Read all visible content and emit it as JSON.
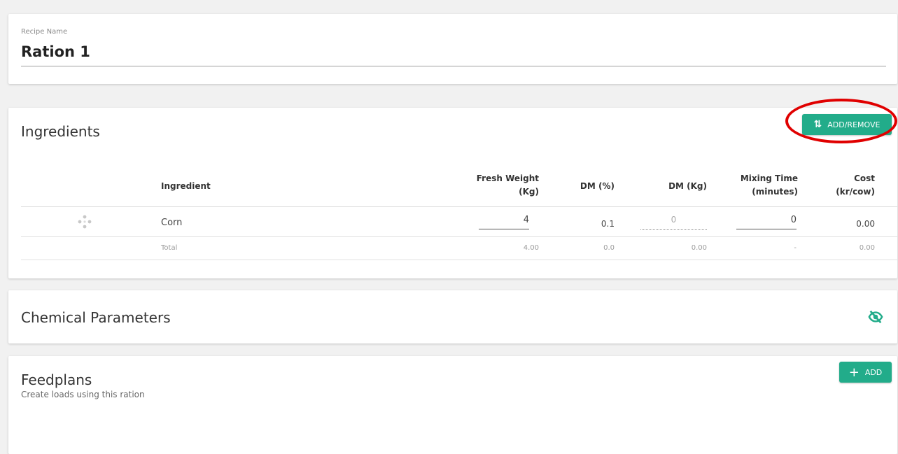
{
  "recipe": {
    "label": "Recipe Name",
    "name": "Ration 1"
  },
  "ingredients": {
    "title": "Ingredients",
    "add_remove_label": "ADD/REMOVE",
    "add_remove_icon": "swap-vertical-icon",
    "columns": {
      "ingredient": "Ingredient",
      "fresh_weight_1": "Fresh Weight",
      "fresh_weight_2": "(Kg)",
      "dm_pct": "DM (%)",
      "dm_kg": "DM (Kg)",
      "mixing_time_1": "Mixing Time",
      "mixing_time_2": "(minutes)",
      "cost_1": "Cost",
      "cost_2": "(kr/cow)"
    },
    "rows": [
      {
        "drag_icon": "drag-move-icon",
        "name": "Corn",
        "fresh_weight": "4",
        "dm_pct": "0.1",
        "dm_kg": "0",
        "mixing_time": "0",
        "cost": "0.00"
      }
    ],
    "total": {
      "label": "Total",
      "fresh_weight": "4.00",
      "dm_pct": "0.0",
      "dm_kg": "0.00",
      "mixing_time": "-",
      "cost": "0.00"
    }
  },
  "chemical": {
    "title": "Chemical Parameters",
    "toggle_icon": "eye-off-icon"
  },
  "feedplans": {
    "title": "Feedplans",
    "subtitle": "Create loads using this ration",
    "add_label": "ADD",
    "add_icon": "plus-icon"
  },
  "colors": {
    "accent": "#22ac8a",
    "highlight": "#e00000",
    "background": "#f1f1f1"
  }
}
